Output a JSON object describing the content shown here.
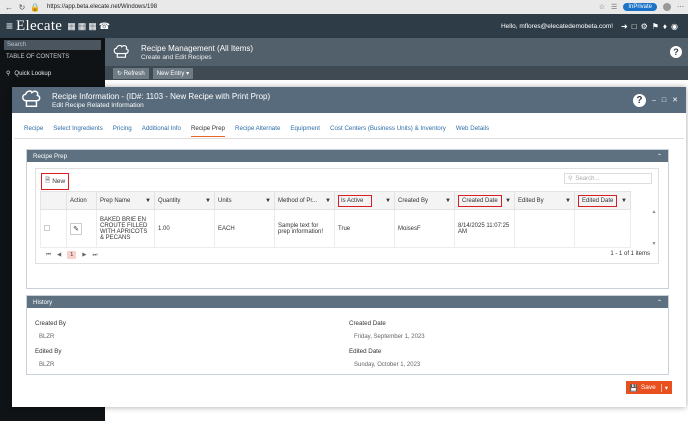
{
  "browser": {
    "url": "https://app.beta.elecate.net/Windows/198",
    "inprivate_label": "InPrivate"
  },
  "app": {
    "logo": "Elecate",
    "user_greeting": "Hello, mflores@elecatedemobeta.com!"
  },
  "sidebar": {
    "search_placeholder": "Search",
    "toc_label": "TABLE OF CONTENTS",
    "quick_lookup": "Quick Lookup"
  },
  "page": {
    "title": "Recipe Management (All Items)",
    "subtitle": "Create and Edit Recipes",
    "refresh_label": "Refresh",
    "new_entry_label": "New Entry"
  },
  "modal": {
    "title": "Recipe Information - (ID#: 1103 - New Recipe with Print Prop)",
    "subtitle": "Edit Recipe Related Information",
    "tabs": [
      {
        "label": "Recipe"
      },
      {
        "label": "Select Ingredients"
      },
      {
        "label": "Pricing"
      },
      {
        "label": "Additional Info"
      },
      {
        "label": "Recipe Prep",
        "active": true
      },
      {
        "label": "Recipe Alternate"
      },
      {
        "label": "Equipment"
      },
      {
        "label": "Cost Centers (Business Units) & Inventory"
      },
      {
        "label": "Web Details"
      }
    ],
    "recipe_prep": {
      "panel_title": "Recipe Prep",
      "new_label": "New",
      "search_placeholder": "Search...",
      "columns": [
        "Action",
        "Prep Name",
        "Quantity",
        "Units",
        "Method of Pr...",
        "Is Active",
        "Created By",
        "Created Date",
        "Edited By",
        "Edited Date"
      ],
      "rows": [
        {
          "prep_name": "BAKED BRIE EN CROUTE FILLED WITH APRICOTS & PECANS",
          "quantity": "1.00",
          "units": "EACH",
          "method": "Sample text for prep information!",
          "is_active": "True",
          "created_by": "MoisesF",
          "created_date": "8/14/2025 11:07:25 AM",
          "edited_by": "",
          "edited_date": ""
        }
      ],
      "pager": {
        "current_page": "1",
        "info": "1 - 1 of 1 items"
      }
    },
    "history": {
      "panel_title": "History",
      "created_by_label": "Created By",
      "created_by_value": "BLZR",
      "created_date_label": "Created Date",
      "created_date_value": "Friday, September 1, 2023",
      "edited_by_label": "Edited By",
      "edited_by_value": "BLZR",
      "edited_date_label": "Edited Date",
      "edited_date_value": "Sunday, October 1, 2023"
    },
    "save_label": "Save"
  },
  "colors": {
    "header_dark": "#2e3c47",
    "modal_header": "#586b7d",
    "accent_orange": "#e9501f",
    "highlight_red": "#d81f26"
  }
}
